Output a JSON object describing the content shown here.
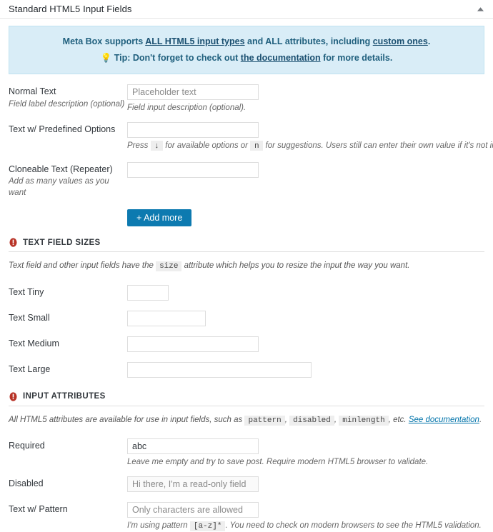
{
  "postbox": {
    "title": "Standard HTML5 Input Fields",
    "toggle_icon": "chevron-up-icon"
  },
  "notice": {
    "line1_part1": "Meta Box supports ",
    "line1_link1": "ALL HTML5 input types",
    "line1_part2": " and ALL attributes, including ",
    "line1_link2": "custom ones",
    "line1_part3": ".",
    "bulb_icon": "lightbulb-icon",
    "bulb_glyph": "💡",
    "line2_part1": "Tip: Don't forget to check out ",
    "line2_link": "the documentation",
    "line2_part2": " for more details."
  },
  "fields": {
    "normal_text": {
      "label": "Normal Text",
      "label_desc": "Field label description (optional)",
      "placeholder": "Placeholder text",
      "value": "",
      "input_desc": "Field input description (optional)."
    },
    "predefined_options": {
      "label": "Text w/ Predefined Options",
      "value": "",
      "desc_part1": "Press ",
      "key1": "↓",
      "desc_part2": " for available options or ",
      "key2": "n",
      "desc_part3": " for suggestions. Users still can enter their own value if it's not in the list."
    },
    "cloneable_text": {
      "label": "Cloneable Text (Repeater)",
      "label_desc": "Add as many values as you want",
      "value": "",
      "add_more_label": "+ Add more"
    }
  },
  "sizes_section": {
    "icon": "info-icon",
    "title": "TEXT FIELD SIZES",
    "desc_part1": "Text field and other input fields have the ",
    "desc_code": "size",
    "desc_part2": " attribute which helps you to resize the input the way you want.",
    "rows": [
      {
        "label": "Text Tiny",
        "value": "",
        "size": "tiny"
      },
      {
        "label": "Text Small",
        "value": "",
        "size": "small"
      },
      {
        "label": "Text Medium",
        "value": "",
        "size": "medium"
      },
      {
        "label": "Text Large",
        "value": "",
        "size": "large"
      }
    ]
  },
  "attributes_section": {
    "icon": "info-icon",
    "title": "INPUT ATTRIBUTES",
    "desc_part1": "All HTML5 attributes are available for use in input fields, such as ",
    "code1": "pattern",
    "desc_sep1": ", ",
    "code2": "disabled",
    "desc_sep2": ", ",
    "code3": "minlength",
    "desc_part2": ", etc. ",
    "desc_link": "See documentation",
    "desc_part3": ".",
    "required": {
      "label": "Required",
      "value": "abc",
      "desc": "Leave me empty and try to save post. Require modern HTML5 browser to validate."
    },
    "disabled": {
      "label": "Disabled",
      "value": "Hi there, I'm a read-only field"
    },
    "pattern": {
      "label": "Text w/ Pattern",
      "placeholder": "Only characters are allowed",
      "value": "",
      "desc_part1": "I'm using pattern ",
      "desc_code": "[a-z]*",
      "desc_part2": ". You need to check on modern browsers to see the HTML5 validation."
    }
  },
  "colors": {
    "accent_blue": "#0d7ab0",
    "notice_bg": "#d9edf7",
    "notice_text": "#31708f",
    "info_red": "#b83327",
    "link": "#0073aa"
  }
}
